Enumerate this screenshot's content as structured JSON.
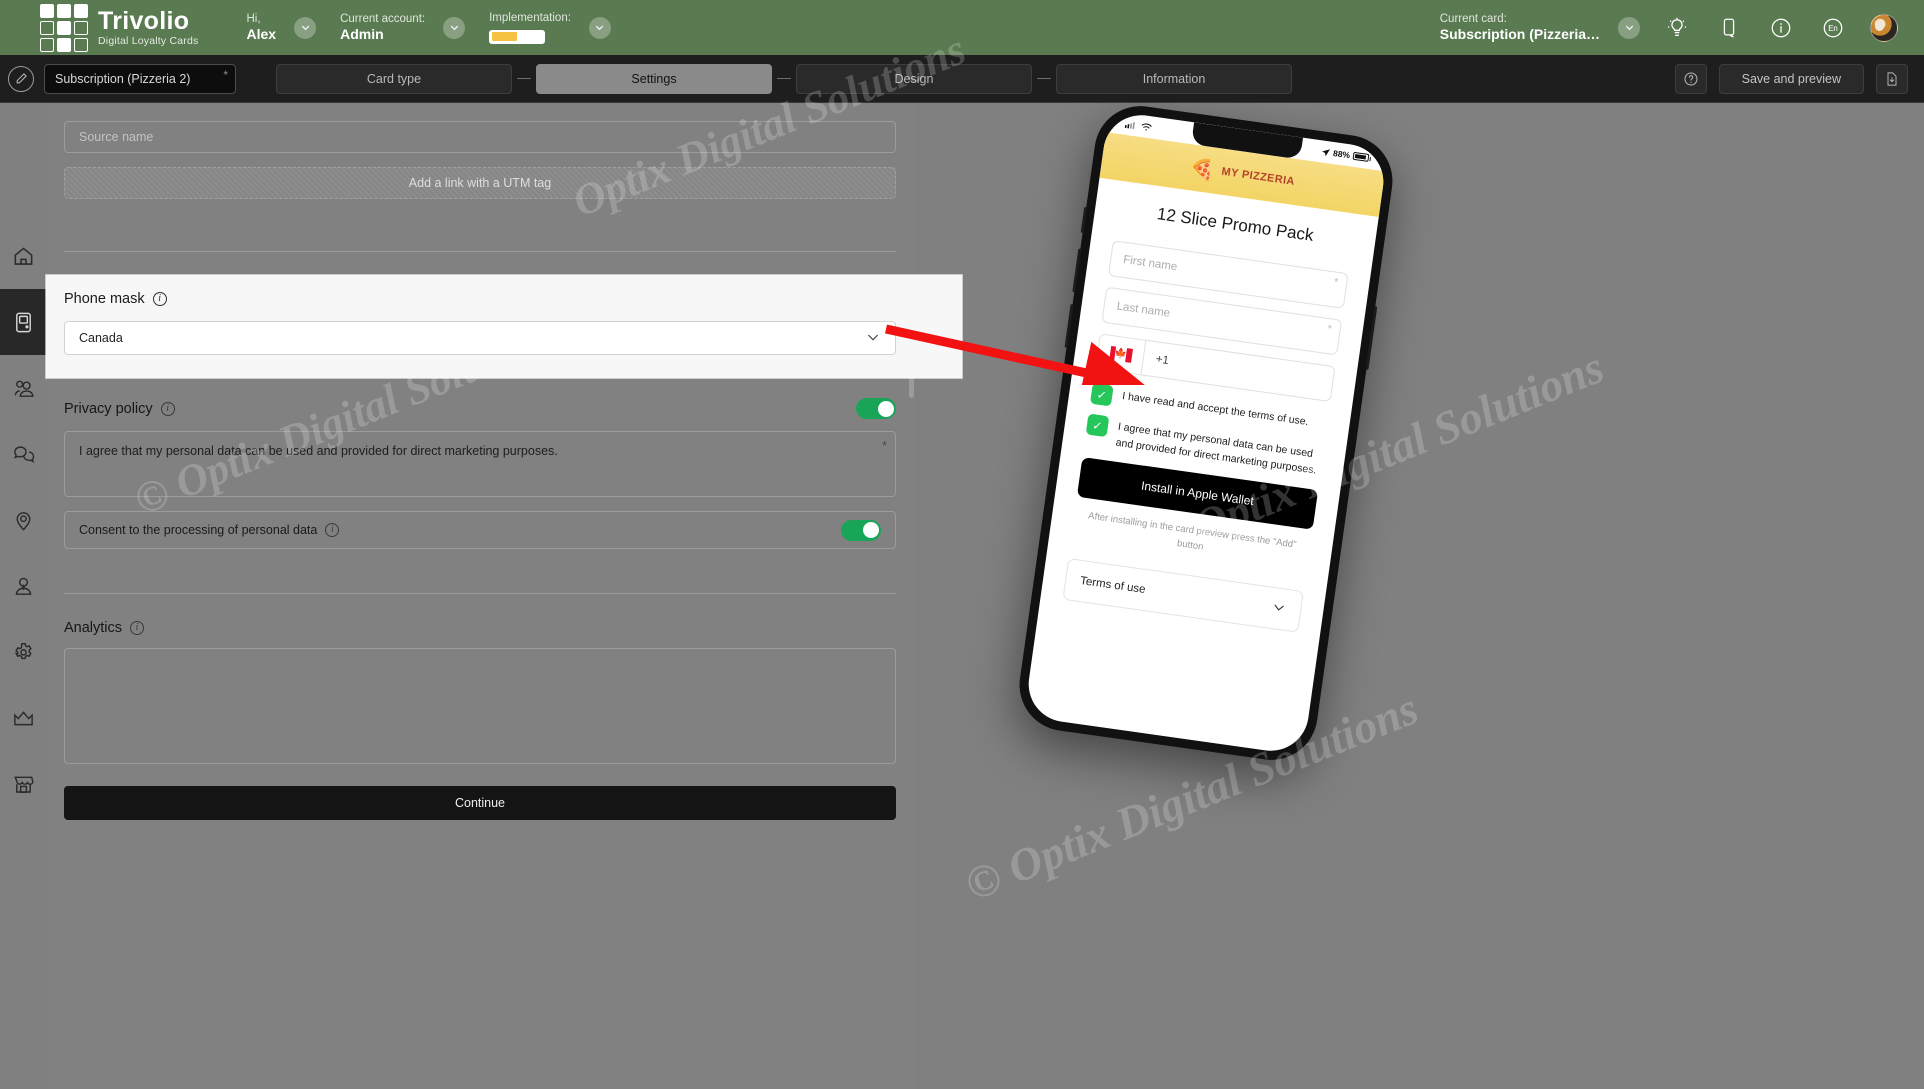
{
  "header": {
    "logo_name": "Trivolio",
    "logo_sub": "Digital Loyalty Cards",
    "greeting_label": "Hi,",
    "greeting_value": "Alex",
    "account_label": "Current account:",
    "account_value": "Admin",
    "implementation_label": "Implementation:",
    "implementation_percent": 50,
    "current_card_label": "Current card:",
    "current_card_value": "Subscription (Pizzeria…",
    "language": "En",
    "icons": [
      "lightbulb-icon",
      "mobile-icon",
      "info-icon",
      "language-icon",
      "avatar"
    ]
  },
  "subbar": {
    "card_pill": "Subscription (Pizzeria 2)",
    "required_mark": "*",
    "steps": [
      {
        "label": "Card type",
        "active": false
      },
      {
        "label": "Settings",
        "active": true
      },
      {
        "label": "Design",
        "active": false
      },
      {
        "label": "Information",
        "active": false
      }
    ],
    "help_label": "?",
    "save_preview_label": "Save and preview",
    "download_icon": "download-file-icon"
  },
  "sidebar": {
    "items": [
      {
        "name": "home",
        "icon": "home-icon",
        "active": false
      },
      {
        "name": "cards",
        "icon": "card-device-icon",
        "active": true
      },
      {
        "name": "clients",
        "icon": "users-group-icon",
        "active": false
      },
      {
        "name": "messages",
        "icon": "chat-bubbles-icon",
        "active": false
      },
      {
        "name": "locations",
        "icon": "map-pin-icon",
        "active": false
      },
      {
        "name": "staff",
        "icon": "user-icon",
        "active": false
      },
      {
        "name": "settings",
        "icon": "gear-icon",
        "active": false
      },
      {
        "name": "premium",
        "icon": "crown-icon",
        "active": false
      },
      {
        "name": "store",
        "icon": "store-icon",
        "active": false
      }
    ]
  },
  "form": {
    "source_name_placeholder": "Source name",
    "utm_button": "Add a link with a UTM tag",
    "phone_mask": {
      "title": "Phone mask",
      "info_icon": "info-icon",
      "selected": "Canada",
      "chevron_icon": "chevron-down-icon"
    },
    "privacy_policy": {
      "title": "Privacy policy",
      "info_icon": "info-icon",
      "toggle_on": true,
      "text": "I agree that my personal data can be used and provided for direct marketing purposes.",
      "required_mark": "*"
    },
    "consent": {
      "label": "Consent to the processing of personal data",
      "info_icon": "info-icon",
      "toggle_on": true
    },
    "analytics": {
      "title": "Analytics",
      "info_icon": "info-icon"
    },
    "continue_label": "Continue"
  },
  "preview": {
    "status_time_battery": "88%",
    "brand_name": "MY PIZZERIA",
    "brand_icon": "pizza-slice-icon",
    "promo_title": "12 Slice Promo Pack",
    "first_name_placeholder": "First name",
    "last_name_placeholder": "Last name",
    "required_mark": "*",
    "country_flag": "canada-flag-icon",
    "phone_code": "+1",
    "checkbox1": "I have read and accept the terms of use.",
    "checkbox2": "I agree that my personal data can be used and provided for direct marketing purposes.",
    "wallet_button": "Install in Apple Wallet",
    "after_note": "After installing in the card preview press the \"Add\" button",
    "terms_label": "Terms of use",
    "terms_chevron": "chevron-down-icon"
  },
  "watermark": {
    "line1": "Optix Digital Solutions",
    "line2": "© Optix Digital Solutions",
    "line3": "Optix Digital Solutions",
    "line4": "© Optix Digital Solutions"
  }
}
